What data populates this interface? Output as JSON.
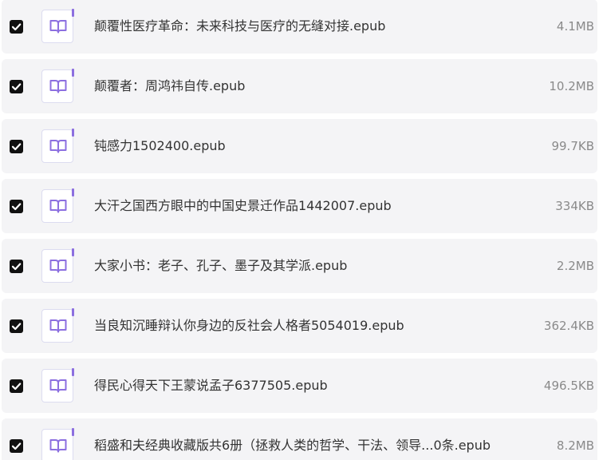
{
  "files": [
    {
      "name": "颠覆性医疗革命：未来科技与医疗的无缝对接.epub",
      "size": "4.1MB",
      "checked": true,
      "icon": "book-icon"
    },
    {
      "name": "颠覆者：周鸿祎自传.epub",
      "size": "10.2MB",
      "checked": true,
      "icon": "book-icon"
    },
    {
      "name": "钝感力1502400.epub",
      "size": "99.7KB",
      "checked": true,
      "icon": "book-icon"
    },
    {
      "name": "大汗之国西方眼中的中国史景迁作品1442007.epub",
      "size": "334KB",
      "checked": true,
      "icon": "book-icon"
    },
    {
      "name": "大家小书：老子、孔子、墨子及其学派.epub",
      "size": "2.2MB",
      "checked": true,
      "icon": "book-icon"
    },
    {
      "name": "当良知沉睡辩认你身边的反社会人格者5054019.epub",
      "size": "362.4KB",
      "checked": true,
      "icon": "book-icon"
    },
    {
      "name": "得民心得天下王蒙说孟子6377505.epub",
      "size": "496.5KB",
      "checked": true,
      "icon": "book-icon"
    },
    {
      "name": "稻盛和夫经典收藏版共6册（拯救人类的哲学、干法、领导...0条.epub",
      "size": "8.2MB",
      "checked": true,
      "icon": "book-icon"
    }
  ],
  "colors": {
    "row_background": "#f4f4f6",
    "checkbox": "#111111",
    "icon_accent": "#8c6fe0",
    "name_text": "#333333",
    "size_text": "#8a8a8a"
  }
}
